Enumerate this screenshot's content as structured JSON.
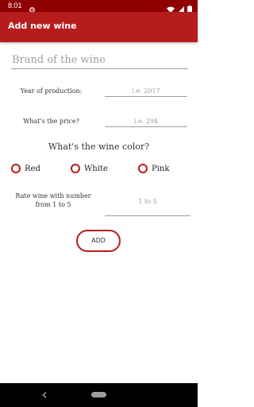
{
  "status_bar": {
    "time": "8:01",
    "icons": [
      "settings-icon",
      "wifi-icon",
      "signal-icon",
      "battery-icon"
    ]
  },
  "app_bar": {
    "title": "Add new wine"
  },
  "form": {
    "brand_placeholder": "Brand of the wine",
    "year_label": "Year of production:",
    "year_placeholder": "i.e. 2017",
    "price_label": "What's the price?",
    "price_placeholder": "i.e. 29$",
    "color_heading": "What's the wine color?",
    "color_options": [
      {
        "label": "Red",
        "selected": false
      },
      {
        "label": "White",
        "selected": false
      },
      {
        "label": "Pink",
        "selected": false
      }
    ],
    "rate_label": "Rate wine with number from 1 to 5",
    "rate_placeholder": "1 to 5",
    "add_label": "ADD"
  },
  "nav_bar": {
    "icons": [
      "back-icon",
      "home-pill-icon"
    ]
  },
  "colors": {
    "app_bar": "#b71c1c",
    "status_bar": "#8e0000",
    "accent": "#b71c1c"
  }
}
